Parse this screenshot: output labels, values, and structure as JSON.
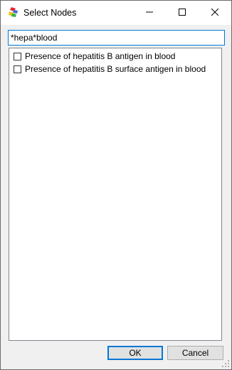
{
  "window": {
    "title": "Select Nodes"
  },
  "icons": {
    "app": "app-icon",
    "minimize": "minimize-icon",
    "maximize": "maximize-icon",
    "close": "close-icon"
  },
  "search": {
    "value": "*hepa*blood"
  },
  "list": {
    "items": [
      {
        "label": "Presence of hepatitis B antigen in blood",
        "checked": false
      },
      {
        "label": "Presence of hepatitis B surface antigen in blood",
        "checked": false
      }
    ]
  },
  "buttons": {
    "ok": "OK",
    "cancel": "Cancel"
  },
  "colors": {
    "focus": "#0078d7",
    "dialog_bg": "#f0f0f0"
  }
}
